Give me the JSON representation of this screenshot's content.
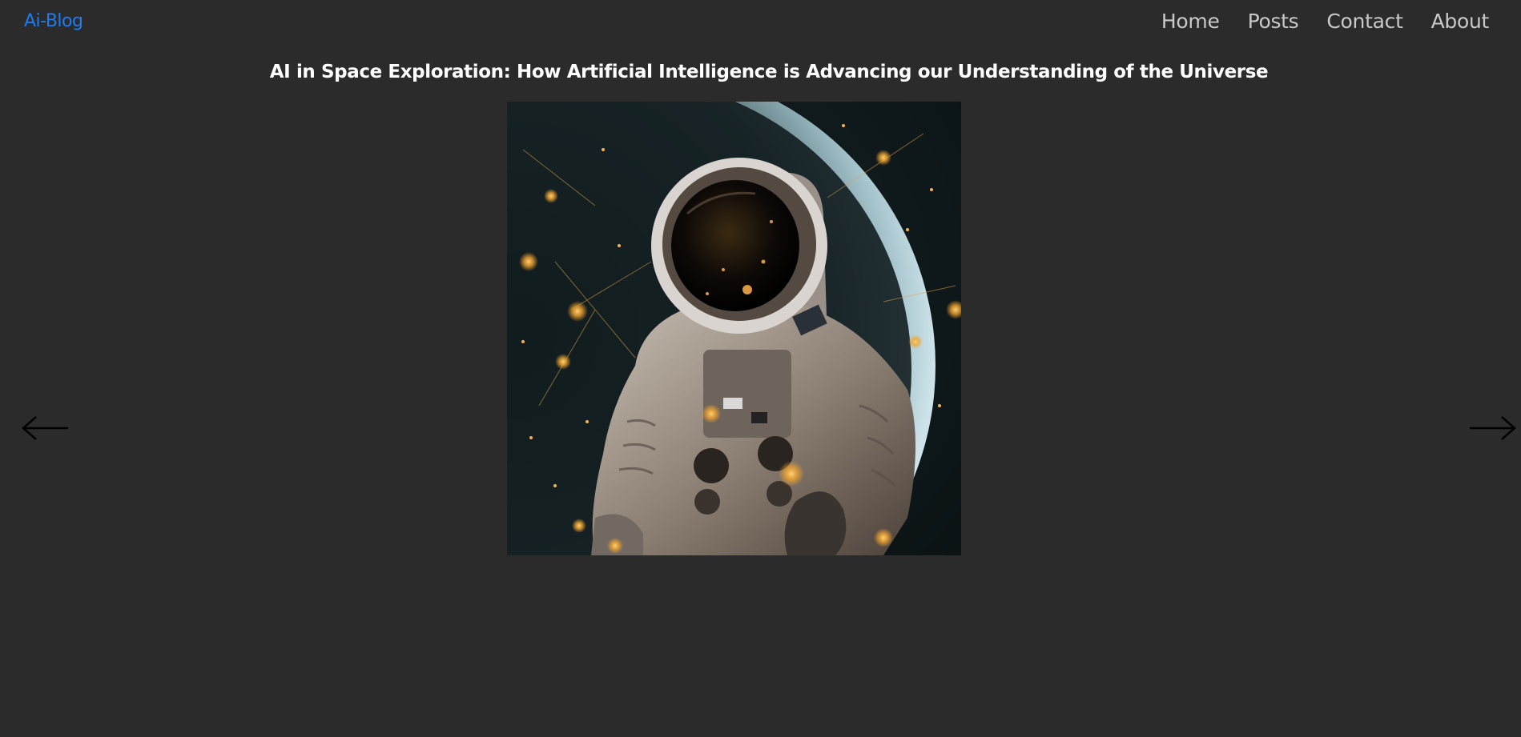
{
  "header": {
    "logo": "Ai-Blog",
    "nav": [
      "Home",
      "Posts",
      "Contact",
      "About"
    ]
  },
  "post": {
    "title": "AI in Space Exploration: How Artificial Intelligence is Advancing our Understanding of the Universe",
    "image_subject": "astronaut in space suit floating in front of a planet with glowing stars"
  },
  "carousel": {
    "prev_icon": "arrow-left-icon",
    "next_icon": "arrow-right-icon"
  },
  "colors": {
    "background": "#2b2b2b",
    "logo": "#1e7cf2",
    "nav_text": "#c9c9c9",
    "title": "#ffffff"
  }
}
